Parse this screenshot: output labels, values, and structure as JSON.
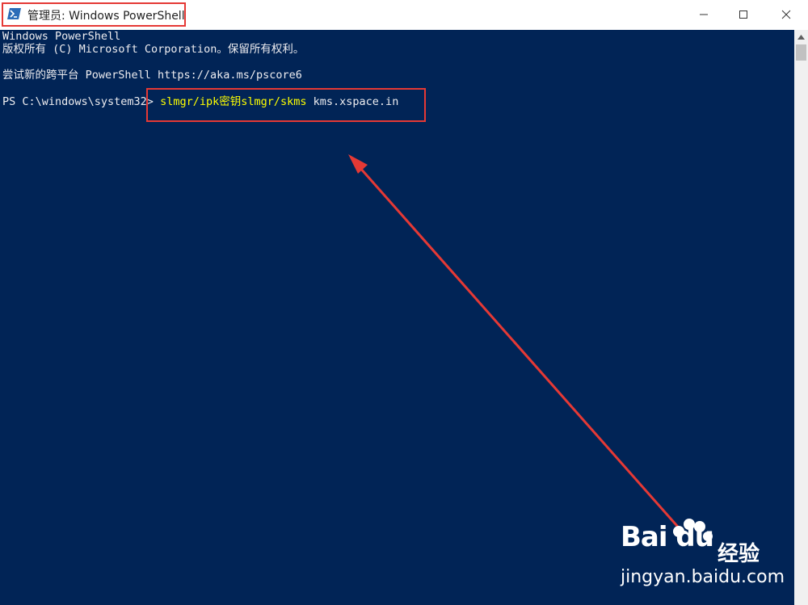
{
  "window": {
    "title": "管理员: Windows PowerShell"
  },
  "console": {
    "lines": [
      "Windows PowerShell",
      "版权所有 (C) Microsoft Corporation。保留所有权利。",
      "尝试新的跨平台 PowerShell https://aka.ms/pscore6"
    ],
    "prompt": "PS C:\\windows\\system32>",
    "command": "slmgr/ipk密钥slmgr/skms",
    "argument": "kms.xspace.in"
  },
  "colors": {
    "console_bg": "#012456",
    "command_text": "#ffff00",
    "highlight": "#e53935"
  },
  "icons": {
    "app": "powershell-icon",
    "minimize": "minimize-icon",
    "maximize": "maximize-icon",
    "close": "close-icon"
  },
  "watermark": {
    "logo_text": "Bai du",
    "cn_text": "经验",
    "url": "jingyan.baidu.com"
  }
}
